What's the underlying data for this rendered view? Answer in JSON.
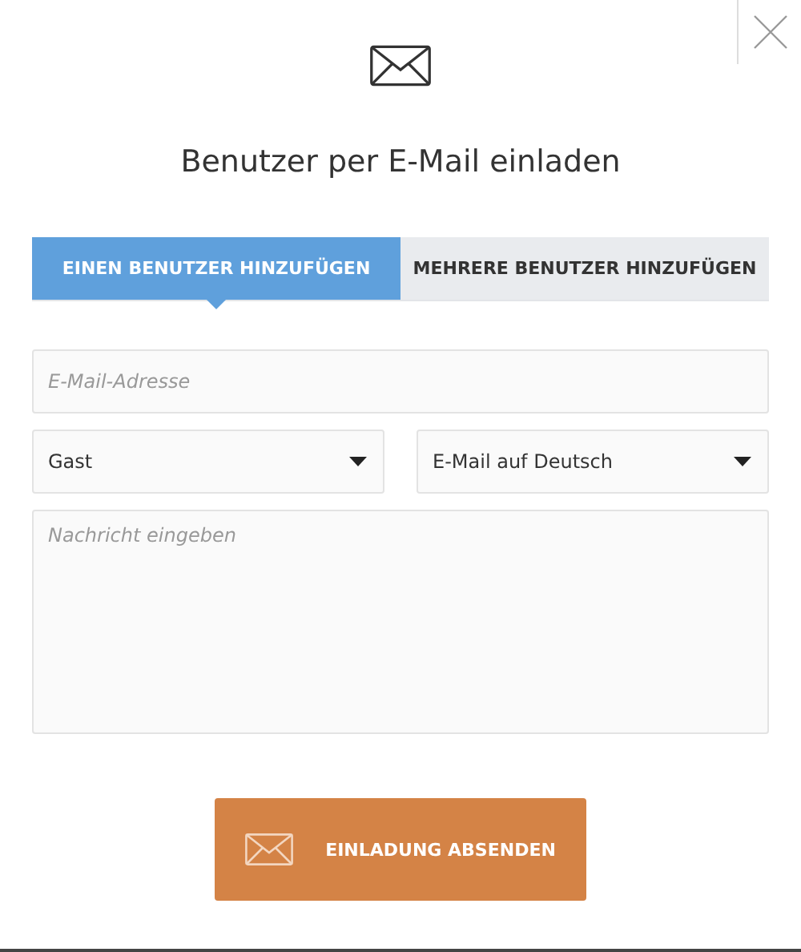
{
  "dialog": {
    "title": "Benutzer per E-Mail einladen"
  },
  "tabs": [
    {
      "label": "EINEN BENUTZER HINZUFÜGEN",
      "selected": true
    },
    {
      "label": "MEHRERE BENUTZER HINZUFÜGEN",
      "selected": false
    }
  ],
  "email": {
    "placeholder": "E-Mail-Adresse"
  },
  "selects": [
    {
      "value": "Gast"
    },
    {
      "value": "E-Mail auf Deutsch"
    }
  ],
  "message": {
    "placeholder": "Nachricht eingeben"
  },
  "submit": {
    "label": "EINLADUNG ABSENDEN"
  }
}
